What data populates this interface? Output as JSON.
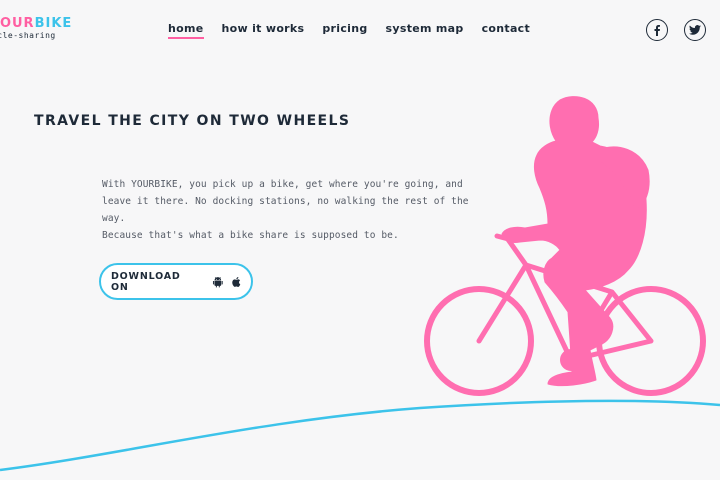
{
  "header": {
    "logo": {
      "title_part1": "YOUR",
      "title_part2": "BIKE",
      "subtitle": "bicycle-sharing"
    },
    "nav": [
      {
        "label": "home",
        "active": true
      },
      {
        "label": "how it works",
        "active": false
      },
      {
        "label": "pricing",
        "active": false
      },
      {
        "label": "system map",
        "active": false
      },
      {
        "label": "contact",
        "active": false
      }
    ],
    "social": [
      "facebook-icon",
      "twitter-icon"
    ]
  },
  "hero": {
    "headline": "TRAVEL THE CITY ON TWO WHEELS",
    "body_line1": "With YOURBIKE, you pick up a bike, get where you're going, and",
    "body_line2": "leave it there. No docking stations, no walking the rest of the way.",
    "body_line3": "Because that's what a bike share is supposed to be.",
    "download_label": "DOWNLOAD ON",
    "store_icons": [
      "android-icon",
      "apple-icon"
    ]
  },
  "colors": {
    "brand_pink": "#ff5fa2",
    "brand_blue": "#3cc3ea",
    "text_dark": "#1e2a38",
    "background": "#f7f7f8"
  }
}
